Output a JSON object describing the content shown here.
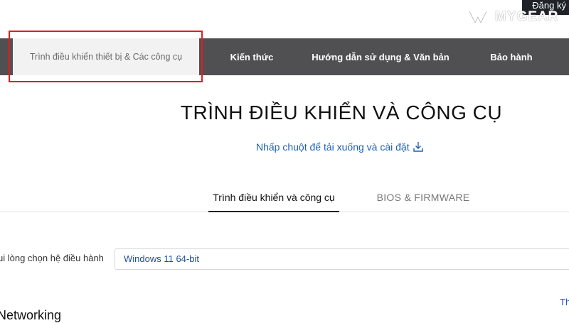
{
  "header": {
    "register_label": "Đăng ký",
    "watermark_text": "MYGEAR"
  },
  "nav": {
    "active_tab": "Trình điều khiển thiết bị & Các công cụ",
    "items": [
      "Kiến thức",
      "Hướng dẫn sử dụng & Văn bản",
      "Bảo hành"
    ]
  },
  "main": {
    "title": "TRÌNH ĐIỀU KHIỂN VÀ CÔNG CỤ",
    "download_link": "Nhấp chuột để tải xuống và cài đặt",
    "tabs": [
      "Trình điều khiển và công cụ",
      "BIOS & FIRMWARE"
    ],
    "os_label": "ui lòng chọn hệ điều hành",
    "os_value": "Windows 11 64-bit",
    "right_link": "Th",
    "section_title": "Networking"
  },
  "colors": {
    "nav_bg": "#505052",
    "highlight_border": "#e31b23",
    "link": "#1d5fb6"
  }
}
